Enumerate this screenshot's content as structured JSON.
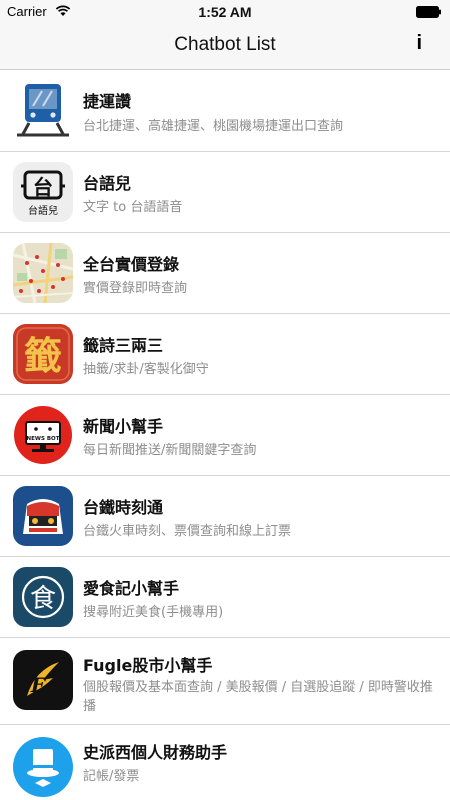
{
  "status_bar": {
    "carrier": "Carrier",
    "time": "1:52 AM"
  },
  "nav": {
    "title": "Chatbot List",
    "info": "i"
  },
  "bots": [
    {
      "title": "捷運讚",
      "subtitle": "台北捷運、高雄捷運、桃園機場捷運出口查詢",
      "icon": "metro-train-icon"
    },
    {
      "title": "台語兒",
      "subtitle": "文字 to 台語語音",
      "icon": "taiwanese-speaker-icon",
      "icon_text_top": "台",
      "icon_text_bottom": "台語兒"
    },
    {
      "title": "全台實價登錄",
      "subtitle": "實價登錄即時查詢",
      "icon": "real-estate-map-icon"
    },
    {
      "title": "籤詩三兩三",
      "subtitle": "抽籤/求卦/客製化御守",
      "icon": "fortune-stick-icon",
      "icon_text": "籤"
    },
    {
      "title": "新聞小幫手",
      "subtitle": "每日新聞推送/新聞關鍵字查詢",
      "icon": "news-bot-icon",
      "icon_text": "NEWS BOT"
    },
    {
      "title": "台鐵時刻通",
      "subtitle": "台鐵火車時刻、票價查詢和線上訂票",
      "icon": "railway-train-icon"
    },
    {
      "title": "愛食記小幫手",
      "subtitle": "搜尋附近美食(手機專用)",
      "icon": "food-seal-icon",
      "icon_text": "食"
    },
    {
      "title": "Fugle股市小幫手",
      "subtitle": "個股報價及基本面查詢 / 美股報價 / 自選股追蹤 / 即時警收推播",
      "icon": "fugle-logo-icon",
      "icon_text": "F"
    },
    {
      "title": "史派西個人財務助手",
      "subtitle": "記帳/發票",
      "icon": "top-hat-icon"
    }
  ],
  "colors": {
    "background": "#ffffff",
    "bar_background": "#f7f7f7",
    "subtitle": "#8e8e8e",
    "separator": "#d6d6d6"
  }
}
